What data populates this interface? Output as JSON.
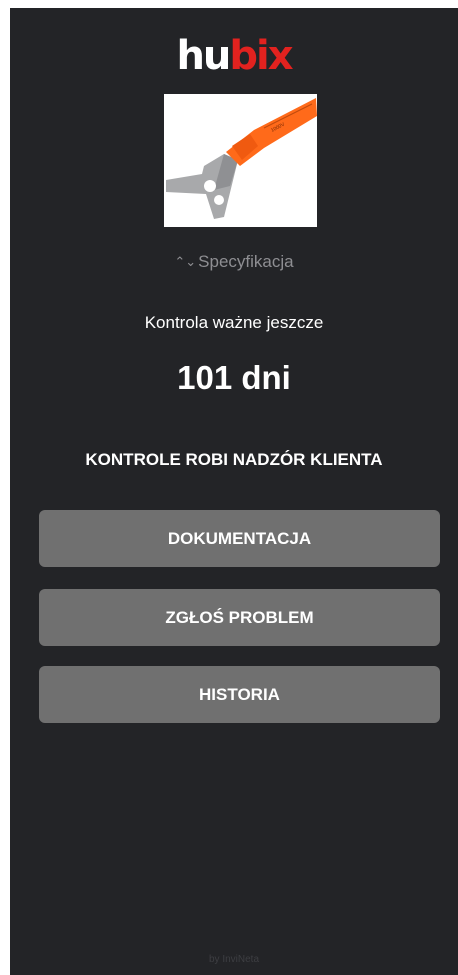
{
  "header": {
    "logo_part1": "hu",
    "logo_part2": "bix"
  },
  "product": {
    "image_icon": "insulated-scraper-tool-icon"
  },
  "spec_toggle": {
    "icon": "chevron-up-down-icon",
    "label": "Specyfikacja"
  },
  "inspection": {
    "label": "Kontrola ważne jeszcze",
    "days_value": "101 dni",
    "notice": "KONTROLE ROBI NADZÓR KLIENTA"
  },
  "actions": {
    "documentation": "DOKUMENTACJA",
    "report_problem": "ZGŁOŚ PROBLEM",
    "history": "HISTORIA"
  },
  "footer": {
    "credit": "by InviNeta"
  },
  "colors": {
    "background": "#232427",
    "button": "#707070",
    "brand_red": "#e2221f",
    "tool_orange": "#ff6a1a"
  }
}
